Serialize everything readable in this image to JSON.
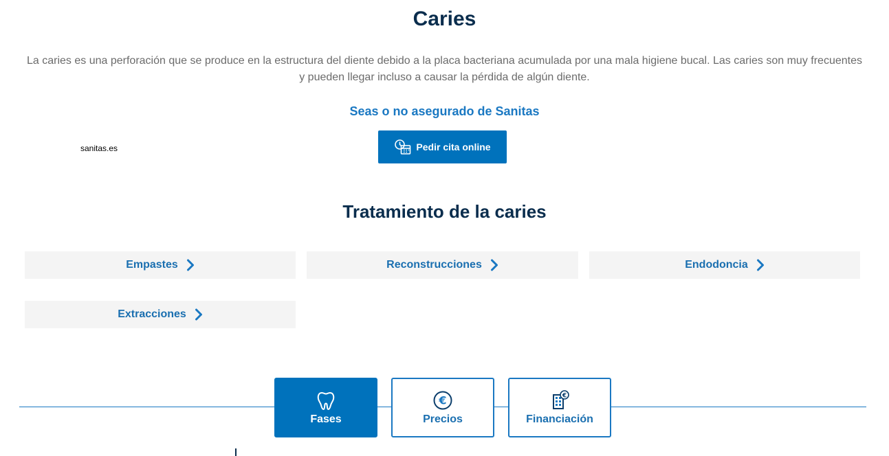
{
  "page": {
    "title": "Caries",
    "intro": "La caries es una perforación que se produce en la estructura del diente debido a la placa bacteriana acumulada por una mala higiene bucal. Las caries son muy frecuentes y pueden llegar incluso a causar la pérdida de algún diente.",
    "subheading": "Seas o no asegurado de Sanitas",
    "watermark": "sanitas.es"
  },
  "cta": {
    "label": "Pedir cita online",
    "icon": "calendar-clock-icon"
  },
  "treatment": {
    "title": "Tratamiento de la caries",
    "items": [
      {
        "label": "Empastes",
        "icon": "chevron-right-icon"
      },
      {
        "label": "Reconstrucciones",
        "icon": "chevron-right-icon"
      },
      {
        "label": "Endodoncia",
        "icon": "chevron-right-icon"
      },
      {
        "label": "Extracciones",
        "icon": "chevron-right-icon"
      }
    ]
  },
  "tabs": [
    {
      "label": "Fases",
      "icon": "tooth-icon",
      "active": true
    },
    {
      "label": "Precios",
      "icon": "euro-icon",
      "active": false
    },
    {
      "label": "Financiación",
      "icon": "financing-building-icon",
      "active": false
    }
  ],
  "colors": {
    "primary": "#0072bc",
    "link": "#1a6fb0",
    "heading": "#0a2d4d",
    "body_text": "#6b6b6b",
    "tile_bg": "#f4f4f4"
  }
}
